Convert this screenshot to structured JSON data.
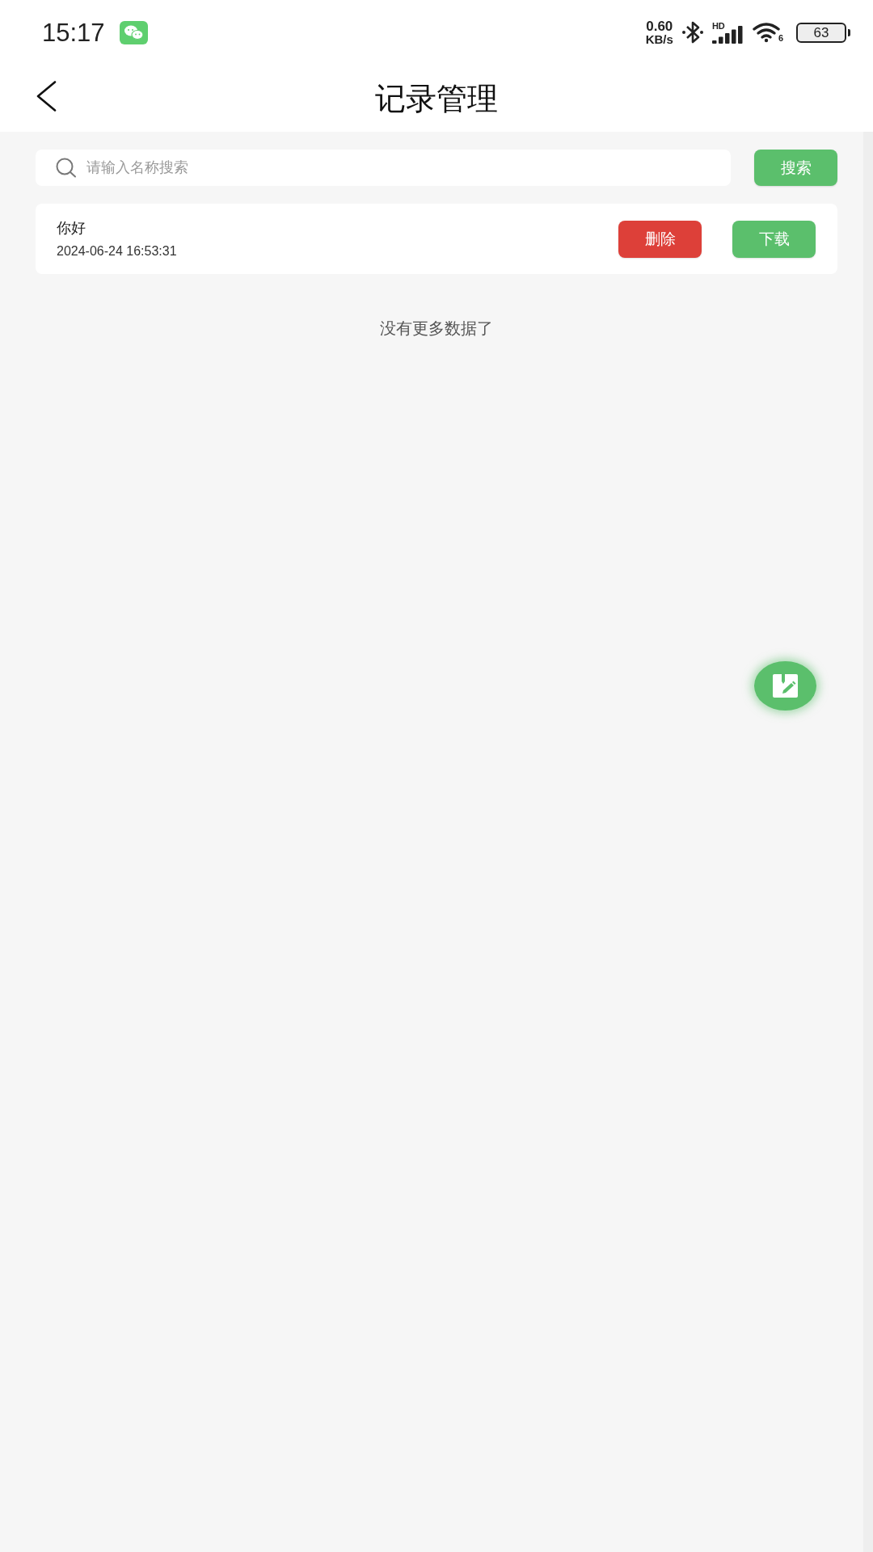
{
  "status_bar": {
    "time": "15:17",
    "network_speed": "0.60",
    "network_unit": "KB/s",
    "signal_label": "HD",
    "wifi_label": "6",
    "battery": "63"
  },
  "header": {
    "title": "记录管理"
  },
  "search": {
    "placeholder": "请输入名称搜索",
    "button": "搜索"
  },
  "records": [
    {
      "name": "你好",
      "time": "2024-06-24 16:53:31",
      "actions": [
        {
          "kind": "delete",
          "label": "删除"
        },
        {
          "kind": "download",
          "label": "下载"
        }
      ]
    }
  ],
  "list_footer": "没有更多数据了"
}
